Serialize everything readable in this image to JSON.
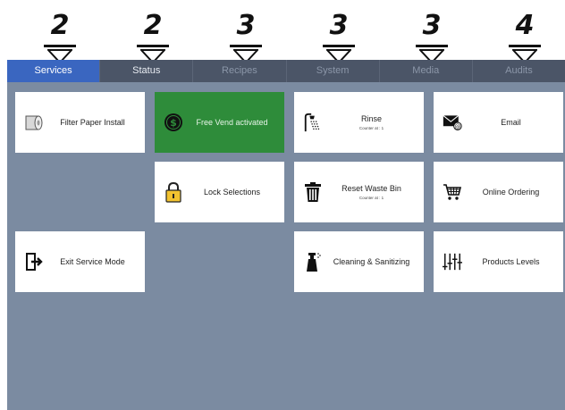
{
  "callouts": [
    "2",
    "2",
    "3",
    "3",
    "3",
    "4"
  ],
  "tabs": [
    {
      "label": "Services",
      "state": "active"
    },
    {
      "label": "Status",
      "state": "enabled"
    },
    {
      "label": "Recipes",
      "state": "disabled"
    },
    {
      "label": "System",
      "state": "disabled"
    },
    {
      "label": "Media",
      "state": "disabled"
    },
    {
      "label": "Audits",
      "state": "disabled"
    }
  ],
  "tiles": {
    "filter_paper": {
      "label": "Filter Paper Install",
      "icon": "paper-roll-icon"
    },
    "free_vend": {
      "label": "Free Vend activated",
      "icon": "dollar-icon",
      "color": "#2e8c3a"
    },
    "rinse": {
      "label": "Rinse",
      "sub": "Counter at : 1",
      "icon": "shower-icon"
    },
    "email": {
      "label": "Email",
      "icon": "email-icon"
    },
    "lock": {
      "label": "Lock Selections",
      "icon": "lock-icon"
    },
    "waste_bin": {
      "label": "Reset Waste Bin",
      "sub": "Counter at : 1",
      "icon": "trash-icon"
    },
    "online_ordering": {
      "label": "Online Ordering",
      "icon": "cart-icon"
    },
    "exit": {
      "label": "Exit Service Mode",
      "icon": "exit-icon"
    },
    "cleaning": {
      "label": "Cleaning & Sanitizing",
      "icon": "spray-icon"
    },
    "products": {
      "label": "Products Levels",
      "icon": "levels-icon"
    }
  },
  "colors": {
    "active_tab": "#3a66c0",
    "tabbar": "#4b5567",
    "screen_bg": "#7b8ba1"
  }
}
